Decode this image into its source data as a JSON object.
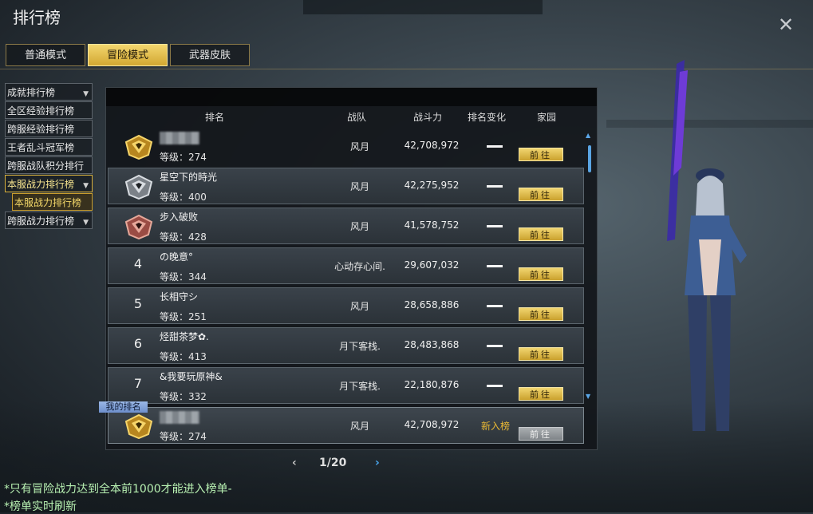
{
  "window": {
    "title": "排行榜",
    "close_icon": "close-icon"
  },
  "tabs": [
    {
      "label": "普通模式",
      "active": false
    },
    {
      "label": "冒险模式",
      "active": true
    },
    {
      "label": "武器皮肤",
      "active": false
    }
  ],
  "sidebar": {
    "items": [
      {
        "label": "成就排行榜",
        "has_chevron": true
      },
      {
        "label": "全区经验排行榜",
        "has_chevron": false
      },
      {
        "label": "跨服经验排行榜",
        "has_chevron": false
      },
      {
        "label": "王者乱斗冠军榜",
        "has_chevron": false
      },
      {
        "label": "跨服战队积分排行",
        "has_chevron": false
      },
      {
        "label": "本服战力排行榜",
        "has_chevron": true,
        "active": true
      },
      {
        "label": "本服战力排行榜",
        "sub": true
      },
      {
        "label": "跨服战力排行榜",
        "has_chevron": true
      }
    ]
  },
  "table": {
    "headers": {
      "rank": "排名",
      "team": "战队",
      "power": "战斗力",
      "change": "排名变化",
      "home": "家园"
    },
    "go_label": "前往",
    "rows": [
      {
        "rank": "1",
        "name": "",
        "blurred": true,
        "level": "等级：274",
        "team": "风月",
        "power": "42,708,972",
        "change": "—",
        "badge": "gold"
      },
      {
        "rank": "2",
        "name": "星空下的時光",
        "blurred": false,
        "level": "等级：400",
        "team": "风月",
        "power": "42,275,952",
        "change": "—",
        "badge": "silver"
      },
      {
        "rank": "3",
        "name": "步入破败",
        "blurred": false,
        "level": "等级：428",
        "team": "风月",
        "power": "41,578,752",
        "change": "—",
        "badge": "bronze"
      },
      {
        "rank": "4",
        "name": "の晚意°",
        "blurred": false,
        "level": "等级：344",
        "team": "心动存心间.",
        "power": "29,607,032",
        "change": "—"
      },
      {
        "rank": "5",
        "name": "长相守シ",
        "blurred": false,
        "level": "等级：251",
        "team": "风月",
        "power": "28,658,886",
        "change": "—"
      },
      {
        "rank": "6",
        "name": "烃甜茶梦✿.",
        "blurred": false,
        "level": "等级：413",
        "team": "月下客栈.",
        "power": "28,483,868",
        "change": "—"
      },
      {
        "rank": "7",
        "name": "&我要玩原神&",
        "blurred": false,
        "level": "等级：332",
        "team": "月下客栈.",
        "power": "22,180,876",
        "change": "—"
      }
    ],
    "my_rank": {
      "tag": "我的排名",
      "name": "",
      "blurred": true,
      "level": "等级：274",
      "team": "风月",
      "power": "42,708,972",
      "change_text": "新入榜",
      "badge": "gold"
    }
  },
  "pager": {
    "prev": "‹",
    "text": "1/20",
    "next": "›"
  },
  "notes": [
    "*只有冒险战力达到全本前1000才能进入榜单-",
    "*榜单实时刷新"
  ],
  "colors": {
    "accent_gold": "#d9b13a",
    "new_entry": "#e9b934",
    "notes": "#b8f1b2",
    "scroll": "#5aa5e3"
  }
}
